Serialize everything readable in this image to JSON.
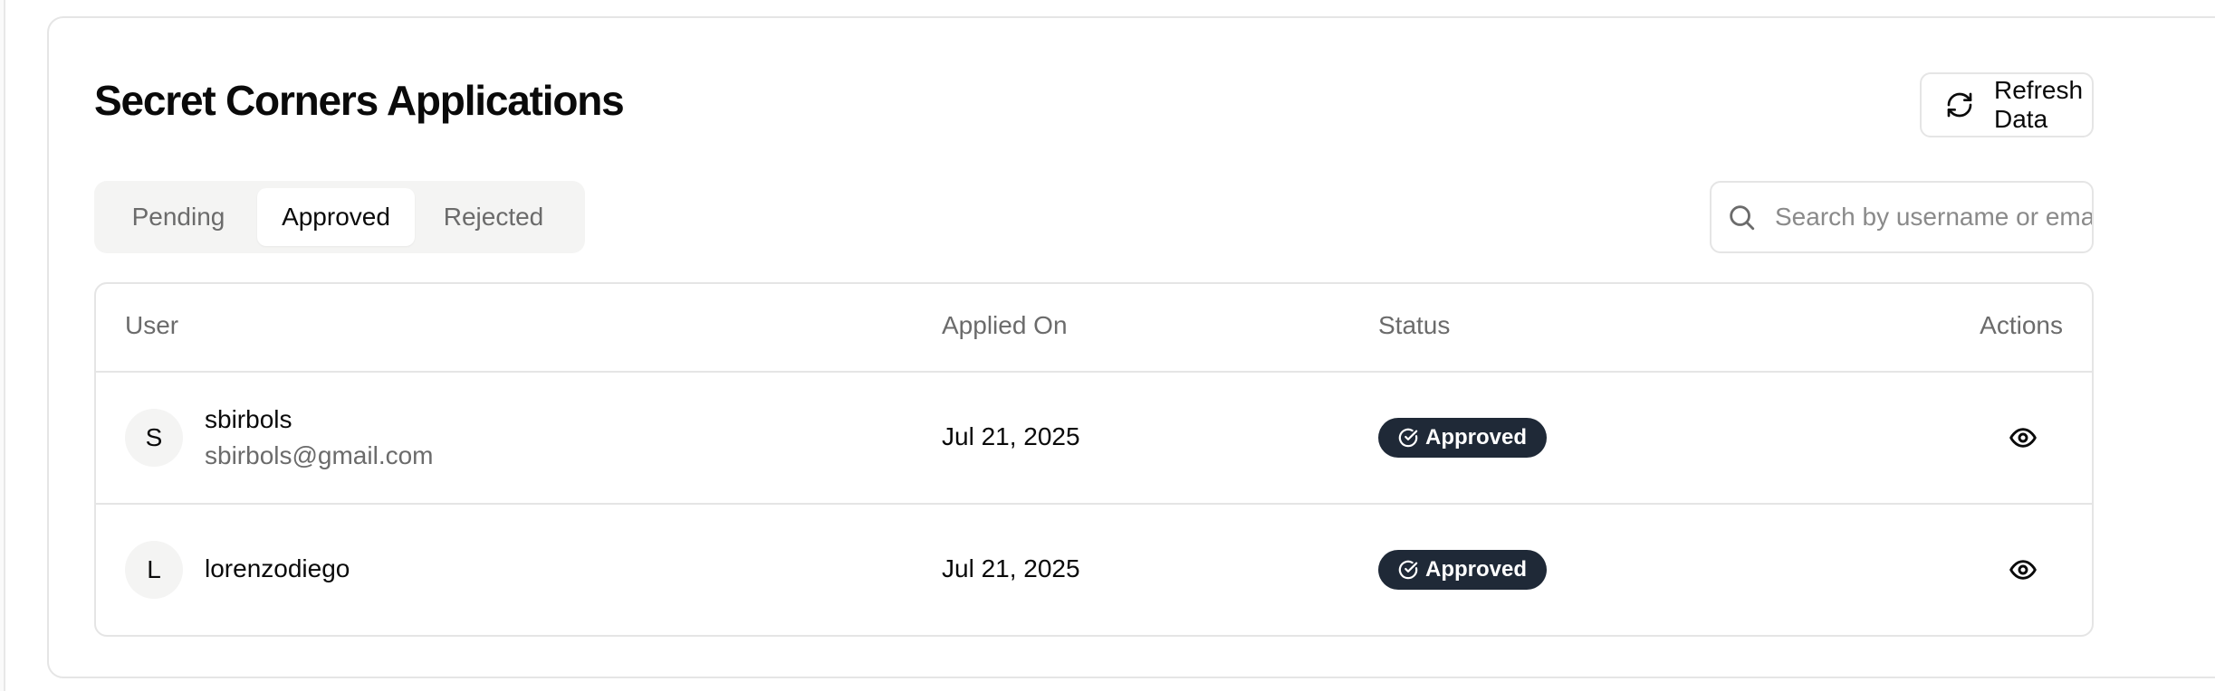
{
  "header": {
    "title": "Secret Corners Applications",
    "refresh_label": "Refresh Data",
    "refresh_icon": "refresh-icon"
  },
  "tabs": [
    {
      "label": "Pending",
      "active": false
    },
    {
      "label": "Approved",
      "active": true
    },
    {
      "label": "Rejected",
      "active": false
    }
  ],
  "search": {
    "placeholder": "Search by username or email...",
    "value": "",
    "icon": "search-icon"
  },
  "table": {
    "columns": [
      "User",
      "Applied On",
      "Status",
      "Actions"
    ],
    "rows": [
      {
        "avatar_initial": "S",
        "username": "sbirbols",
        "email": "sbirbols@gmail.com",
        "applied_on": "Jul 21, 2025",
        "status": "Approved",
        "action_icon": "eye-icon"
      },
      {
        "avatar_initial": "L",
        "username": "lorenzodiego",
        "email": "",
        "applied_on": "Jul 21, 2025",
        "status": "Approved",
        "action_icon": "eye-icon"
      }
    ]
  },
  "colors": {
    "badge_bg": "#1f2937",
    "badge_text": "#ffffff",
    "muted_text": "#6b6b6b",
    "border": "#e5e5e5",
    "tab_bg": "#f4f4f3"
  }
}
